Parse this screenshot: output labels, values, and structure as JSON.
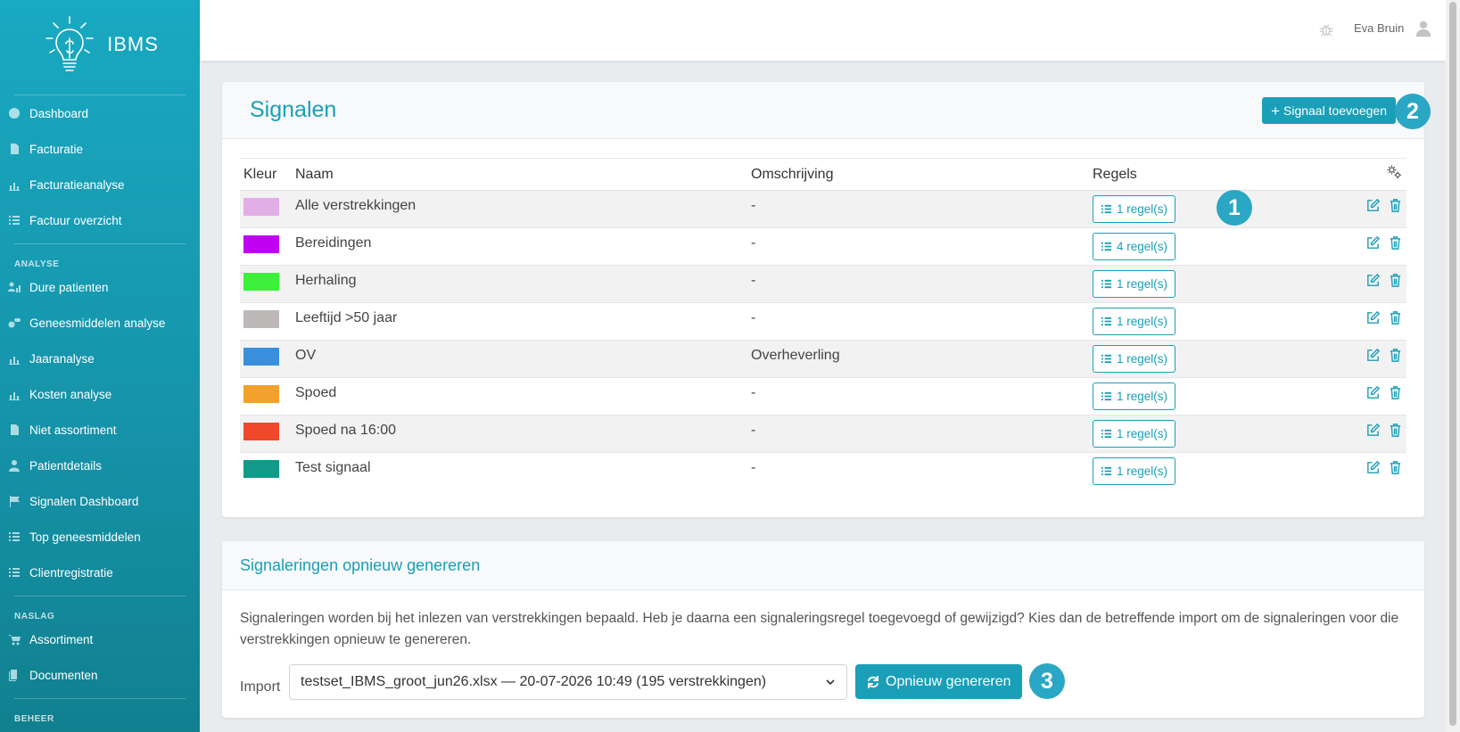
{
  "app": {
    "name": "IBMS"
  },
  "user": {
    "name": "Eva Bruin"
  },
  "sidebar": {
    "items_top": [
      {
        "label": "Dashboard",
        "icon": "dashboard-icon"
      },
      {
        "label": "Facturatie",
        "icon": "file-icon"
      },
      {
        "label": "Facturatieanalyse",
        "icon": "chart-icon"
      },
      {
        "label": "Factuur overzicht",
        "icon": "list-icon"
      }
    ],
    "heading_analyse": "ANALYSE",
    "items_analyse": [
      {
        "label": "Dure patienten",
        "icon": "users-chart-icon"
      },
      {
        "label": "Geneesmiddelen analyse",
        "icon": "pills-icon"
      },
      {
        "label": "Jaaranalyse",
        "icon": "chart-icon"
      },
      {
        "label": "Kosten analyse",
        "icon": "chart-icon"
      },
      {
        "label": "Niet assortiment",
        "icon": "file-icon"
      },
      {
        "label": "Patientdetails",
        "icon": "user-icon"
      },
      {
        "label": "Signalen Dashboard",
        "icon": "flag-icon"
      },
      {
        "label": "Top geneesmiddelen",
        "icon": "list-icon"
      },
      {
        "label": "Clientregistratie",
        "icon": "list-icon"
      }
    ],
    "heading_naslag": "NASLAG",
    "items_naslag": [
      {
        "label": "Assortiment",
        "icon": "cart-icon"
      },
      {
        "label": "Documenten",
        "icon": "documents-icon"
      }
    ],
    "heading_beheer": "BEHEER"
  },
  "signals": {
    "title": "Signalen",
    "add_button": "Signaal toevoegen",
    "columns": {
      "color": "Kleur",
      "name": "Naam",
      "description": "Omschrijving",
      "rules": "Regels"
    },
    "rows": [
      {
        "color": "#e2aee6",
        "name": "Alle verstrekkingen",
        "description": "-",
        "rules": "1 regel(s)"
      },
      {
        "color": "#c000f0",
        "name": "Bereidingen",
        "description": "-",
        "rules": "4 regel(s)"
      },
      {
        "color": "#3cf03c",
        "name": "Herhaling",
        "description": "-",
        "rules": "1 regel(s)"
      },
      {
        "color": "#bdb8b8",
        "name": "Leeftijd >50 jaar",
        "description": "-",
        "rules": "1 regel(s)"
      },
      {
        "color": "#3a8fdc",
        "name": "OV",
        "description": "Overheverling",
        "rules": "1 regel(s)"
      },
      {
        "color": "#f2a12c",
        "name": "Spoed",
        "description": "-",
        "rules": "1 regel(s)"
      },
      {
        "color": "#f0482a",
        "name": "Spoed na 16:00",
        "description": "-",
        "rules": "1 regel(s)"
      },
      {
        "color": "#119a88",
        "name": "Test signaal",
        "description": "-",
        "rules": "1 regel(s)"
      }
    ]
  },
  "regenerate": {
    "title": "Signaleringen opnieuw genereren",
    "description": "Signaleringen worden bij het inlezen van verstrekkingen bepaald. Heb je daarna een signaleringsregel toegevoegd of gewijzigd? Kies dan de betreffende import om de signaleringen voor die verstrekkingen opnieuw te genereren.",
    "import_label": "Import",
    "import_selected": "testset_IBMS_groot_jun26.xlsx — 20-07-2026 10:49 (195 verstrekkingen)",
    "button": "Opnieuw genereren"
  },
  "annotations": {
    "badge1": "1",
    "badge2": "2",
    "badge3": "3"
  },
  "colors": {
    "accent": "#1a9fb8",
    "badge": "#2aa7c4",
    "sidebar": "#19a9c2"
  }
}
